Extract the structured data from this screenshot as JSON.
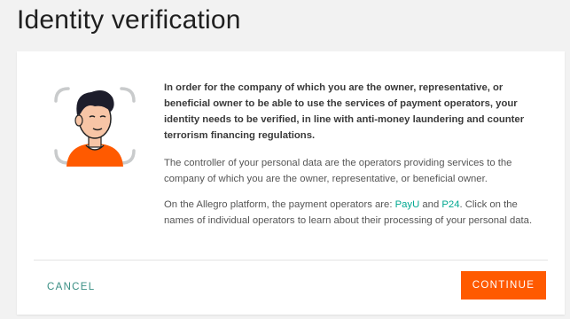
{
  "page": {
    "title": "Identity verification"
  },
  "dialog": {
    "lead": "In order for the company of which you are the owner, representative, or beneficial owner to be able to use the services of payment operators, your identity needs to be verified, in line with anti-money laundering and counter terrorism financing regulations.",
    "controller_text": "The controller of your personal data are the operators providing services to the company of which you are the owner, representative, or beneficial owner.",
    "operators_prefix": "On the Allegro platform, the payment operators are: ",
    "operator_payu": "PayU",
    "operators_and": " and ",
    "operator_p24": "P24",
    "operators_suffix": ". Click on the names of individual operators to learn about their processing of your personal data.",
    "illustration_icon": "face-verification-icon"
  },
  "actions": {
    "cancel_label": "CANCEL",
    "continue_label": "CONTINUE"
  },
  "colors": {
    "accent": "#ff5a00",
    "link": "#00a790",
    "cancel_text": "#3a8f84"
  }
}
